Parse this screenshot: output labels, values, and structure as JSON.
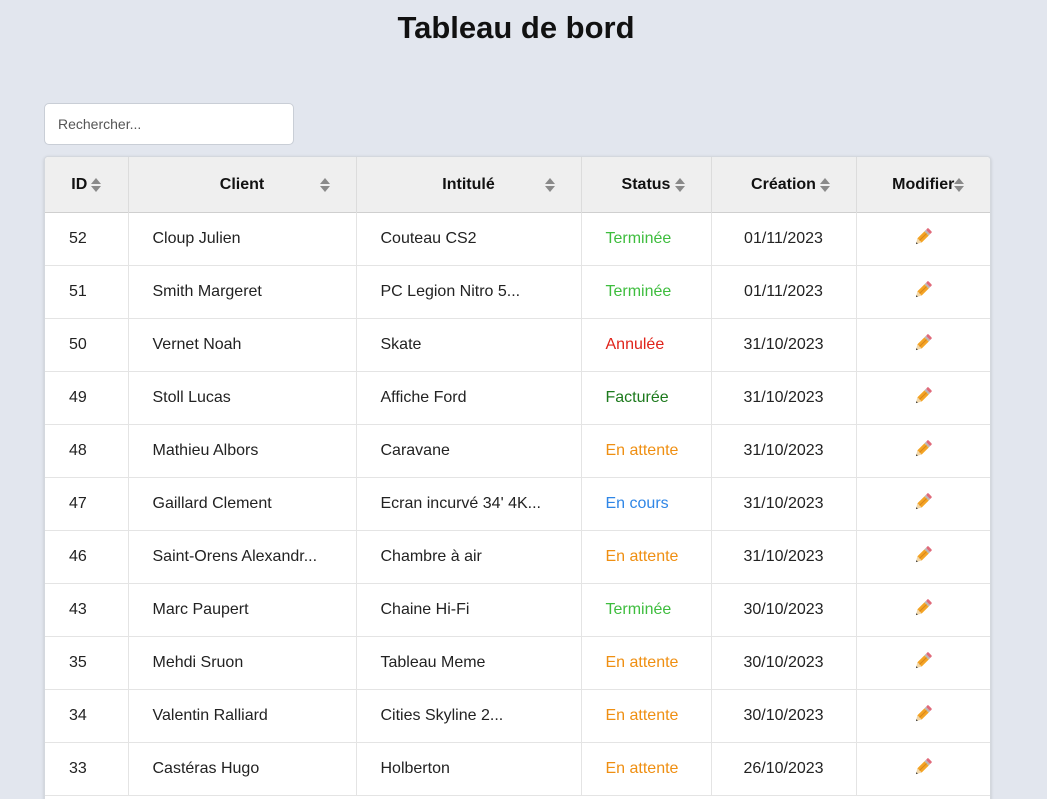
{
  "page": {
    "title": "Tableau de bord"
  },
  "search": {
    "placeholder": "Rechercher...",
    "value": ""
  },
  "table": {
    "headers": {
      "id": "ID",
      "client": "Client",
      "intitule": "Intitulé",
      "status": "Status",
      "creation": "Création",
      "modifier": "Modifier"
    },
    "sort_icon": "sort-icon",
    "edit_icon": "pencil-icon",
    "status_colors": {
      "Terminée": "#3ebd3e",
      "Annulée": "#e0231a",
      "Facturée": "#1d7a1d",
      "En attente": "#ef8f12",
      "En cours": "#2f86e6"
    },
    "rows": [
      {
        "id": "52",
        "client": "Cloup Julien",
        "intitule": "Couteau CS2",
        "status": "Terminée",
        "creation": "01/11/2023"
      },
      {
        "id": "51",
        "client": "Smith Margeret",
        "intitule": "PC Legion Nitro 5...",
        "status": "Terminée",
        "creation": "01/11/2023"
      },
      {
        "id": "50",
        "client": "Vernet Noah",
        "intitule": "Skate",
        "status": "Annulée",
        "creation": "31/10/2023"
      },
      {
        "id": "49",
        "client": "Stoll Lucas",
        "intitule": "Affiche Ford",
        "status": "Facturée",
        "creation": "31/10/2023"
      },
      {
        "id": "48",
        "client": "Mathieu Albors",
        "intitule": "Caravane",
        "status": "En attente",
        "creation": "31/10/2023"
      },
      {
        "id": "47",
        "client": "Gaillard Clement",
        "intitule": "Ecran incurvé 34' 4K...",
        "status": "En cours",
        "creation": "31/10/2023"
      },
      {
        "id": "46",
        "client": "Saint-Orens Alexandr...",
        "intitule": "Chambre à air",
        "status": "En attente",
        "creation": "31/10/2023"
      },
      {
        "id": "43",
        "client": "Marc Paupert",
        "intitule": "Chaine Hi-Fi",
        "status": "Terminée",
        "creation": "30/10/2023"
      },
      {
        "id": "35",
        "client": "Mehdi Sruon",
        "intitule": "Tableau Meme",
        "status": "En attente",
        "creation": "30/10/2023"
      },
      {
        "id": "34",
        "client": "Valentin Ralliard",
        "intitule": "Cities Skyline 2...",
        "status": "En attente",
        "creation": "30/10/2023"
      },
      {
        "id": "33",
        "client": "Castéras Hugo",
        "intitule": "Holberton",
        "status": "En attente",
        "creation": "26/10/2023"
      }
    ]
  }
}
